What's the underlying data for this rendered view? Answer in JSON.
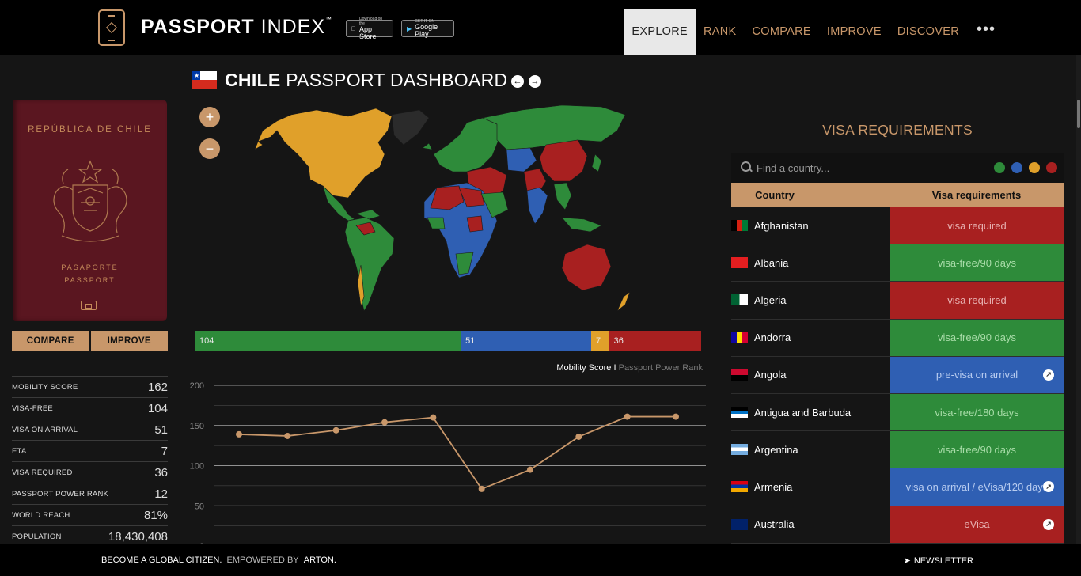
{
  "header": {
    "logo_bold": "PASSPORT",
    "logo_light": "INDEX",
    "logo_tm": "™",
    "appstore_small": "Download on the",
    "appstore_large": "App Store",
    "googleplay_small": "GET IT ON",
    "googleplay_large": "Google Play",
    "nav": [
      "EXPLORE",
      "RANK",
      "COMPARE",
      "IMPROVE",
      "DISCOVER"
    ],
    "nav_more": "•••"
  },
  "passport": {
    "cover_title": "REPÚBLICA DE CHILE",
    "cover_line1": "PASAPORTE",
    "cover_line2": "PASSPORT",
    "compare_label": "COMPARE",
    "improve_label": "IMPROVE"
  },
  "stats": [
    {
      "label": "MOBILITY SCORE",
      "value": "162"
    },
    {
      "label": "VISA-FREE",
      "value": "104"
    },
    {
      "label": "VISA ON ARRIVAL",
      "value": "51"
    },
    {
      "label": "ETA",
      "value": "7"
    },
    {
      "label": "VISA REQUIRED",
      "value": "36"
    },
    {
      "label": "PASSPORT POWER RANK",
      "value": "12"
    },
    {
      "label": "WORLD REACH",
      "value": "81%"
    },
    {
      "label": "POPULATION",
      "value": "18,430,408"
    }
  ],
  "dashboard": {
    "country": "CHILE",
    "title_rest": "PASSPORT DASHBOARD",
    "zoom_in": "+",
    "zoom_out": "−",
    "prev": "←",
    "next": "→",
    "legend_active": "Mobility Score",
    "legend_sep": "I",
    "legend_inactive": "Passport Power Rank"
  },
  "colors": {
    "accent": "#c8976a",
    "visa_free": "#2e8b3a",
    "visa_on_arrival": "#2f5fb3",
    "eta": "#e0a02a",
    "visa_required": "#a82020"
  },
  "breakdown": [
    {
      "label": "104",
      "value": 104,
      "color": "#2e8b3a"
    },
    {
      "label": "51",
      "value": 51,
      "color": "#2f5fb3"
    },
    {
      "label": "7",
      "value": 7,
      "color": "#e0a02a"
    },
    {
      "label": "36",
      "value": 36,
      "color": "#a82020"
    }
  ],
  "chart_data": {
    "type": "line",
    "title": "",
    "xlabel": "",
    "ylabel": "",
    "yticks": [
      "200",
      "150",
      "100",
      "50",
      "0"
    ],
    "ylim": [
      0,
      200
    ],
    "series": [
      {
        "name": "Mobility Score",
        "values": [
          139,
          137,
          144,
          154,
          160,
          71,
          95,
          136,
          161,
          161
        ]
      }
    ],
    "grid": true
  },
  "visa": {
    "title": "VISA REQUIREMENTS",
    "search_placeholder": "Find a country...",
    "col_country": "Country",
    "col_req": "Visa requirements",
    "rows": [
      {
        "country": "Afghanistan",
        "req": "visa required",
        "color": "#a82020",
        "text_color": "#e7b0b0",
        "ext": false,
        "flag": "af"
      },
      {
        "country": "Albania",
        "req": "visa-free/90 days",
        "color": "#2e8b3a",
        "text_color": "#a8dca8",
        "ext": false,
        "flag": "al"
      },
      {
        "country": "Algeria",
        "req": "visa required",
        "color": "#a82020",
        "text_color": "#e7b0b0",
        "ext": false,
        "flag": "dz"
      },
      {
        "country": "Andorra",
        "req": "visa-free/90 days",
        "color": "#2e8b3a",
        "text_color": "#a8dca8",
        "ext": false,
        "flag": "ad"
      },
      {
        "country": "Angola",
        "req": "pre-visa on arrival",
        "color": "#2f5fb3",
        "text_color": "#b8ccf0",
        "ext": true,
        "flag": "ao"
      },
      {
        "country": "Antigua and Barbuda",
        "req": "visa-free/180 days",
        "color": "#2e8b3a",
        "text_color": "#a8dca8",
        "ext": false,
        "flag": "ag"
      },
      {
        "country": "Argentina",
        "req": "visa-free/90 days",
        "color": "#2e8b3a",
        "text_color": "#a8dca8",
        "ext": false,
        "flag": "ar"
      },
      {
        "country": "Armenia",
        "req": "visa on arrival / eVisa/120 days",
        "color": "#2f5fb3",
        "text_color": "#b8ccf0",
        "ext": true,
        "flag": "am"
      },
      {
        "country": "Australia",
        "req": "eVisa",
        "color": "#a82020",
        "text_color": "#e7b0b0",
        "ext": true,
        "flag": "au"
      }
    ]
  },
  "footer": {
    "tagline": "BECOME A GLOBAL CITIZEN.",
    "empowered": "EMPOWERED BY",
    "brand": "ARTON.",
    "newsletter": "NEWSLETTER"
  }
}
